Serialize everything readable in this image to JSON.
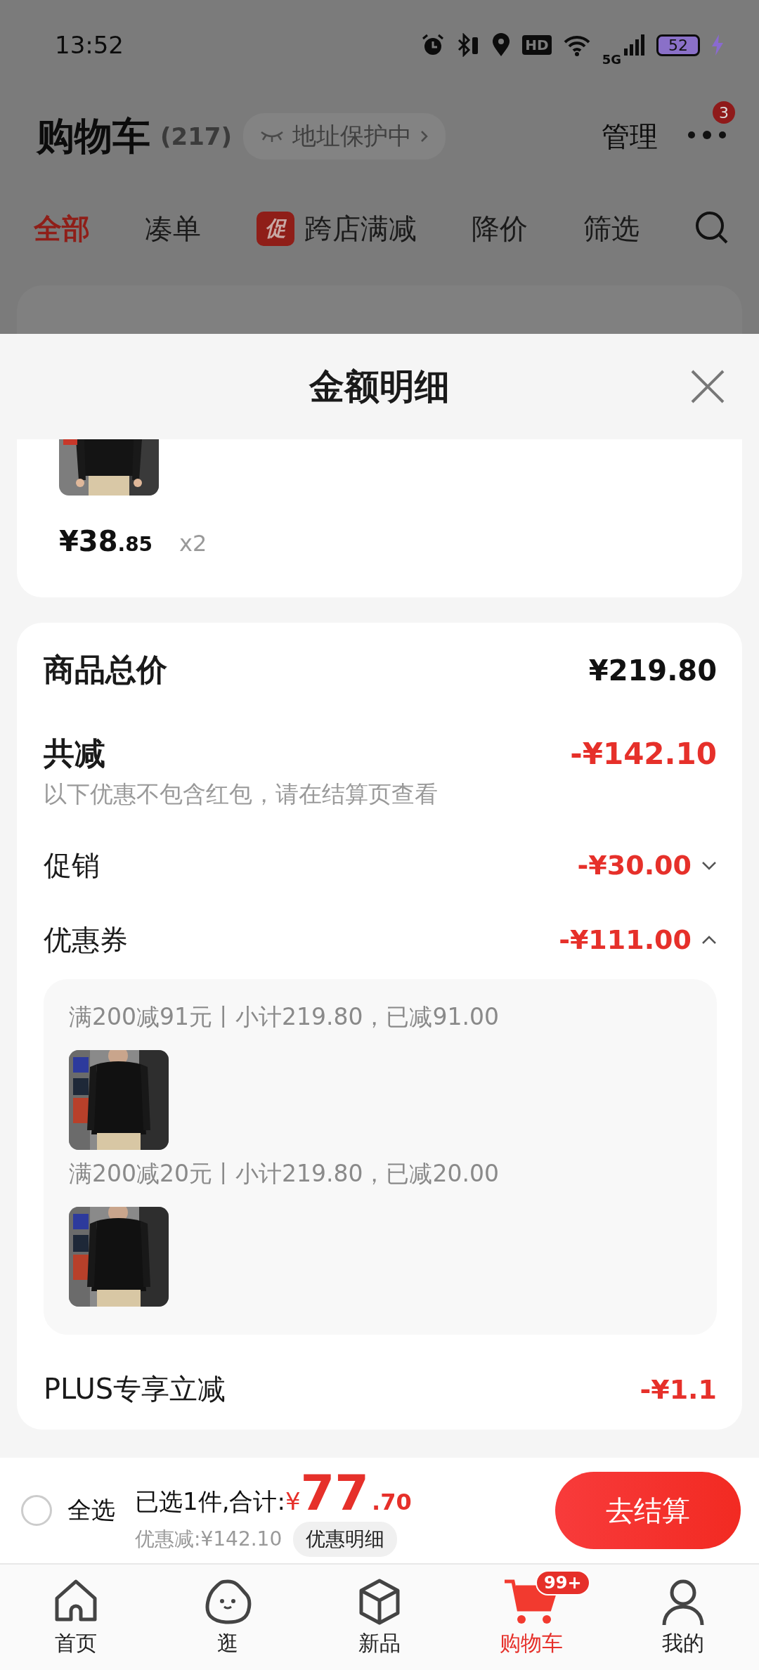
{
  "status_bar": {
    "time": "13:52",
    "hd": "HD",
    "network": "5G",
    "battery": "52"
  },
  "header": {
    "title": "购物车",
    "count": "(217)",
    "address_chip": "地址保护中",
    "manage": "管理",
    "more_badge": "3"
  },
  "filter_tabs": [
    {
      "label": "全部",
      "selected": true
    },
    {
      "label": "凑单",
      "selected": false
    },
    {
      "label": "跨店满减",
      "selected": false,
      "badge": "促"
    },
    {
      "label": "降价",
      "selected": false
    },
    {
      "label": "筛选",
      "selected": false
    }
  ],
  "sheet": {
    "title": "金额明细",
    "item": {
      "price_main": "¥38",
      "price_decimal": ".85",
      "quantity": "x2"
    },
    "summary": {
      "total": {
        "label": "商品总价",
        "value": "¥219.80"
      },
      "reduction": {
        "label": "共减",
        "value": "-¥142.10",
        "note": "以下优惠不包含红包，请在结算页查看"
      },
      "lines": [
        {
          "label": "促销",
          "value": "-¥30.00",
          "expanded": false
        },
        {
          "label": "优惠券",
          "value": "-¥111.00",
          "expanded": true
        }
      ],
      "coupons": [
        {
          "text": "满200减91元丨小计219.80，已减91.00"
        },
        {
          "text": "满200减20元丨小计219.80，已减20.00"
        }
      ],
      "plus": {
        "label": "PLUS专享立减",
        "value": "-¥1.1"
      }
    }
  },
  "checkout": {
    "select_all": {
      "label": "全选",
      "checked": false
    },
    "summary_text": "已选1件,合计:",
    "currency": "¥",
    "amount_int": "77",
    "amount_dec": ".70",
    "discount": "优惠减:¥142.10",
    "detail_button": "优惠明细",
    "checkout_button": "去结算"
  },
  "nav": [
    {
      "label": "首页",
      "selected": false
    },
    {
      "label": "逛",
      "selected": false
    },
    {
      "label": "新品",
      "selected": false
    },
    {
      "label": "购物车",
      "selected": true,
      "badge": "99+"
    },
    {
      "label": "我的",
      "selected": false
    }
  ]
}
